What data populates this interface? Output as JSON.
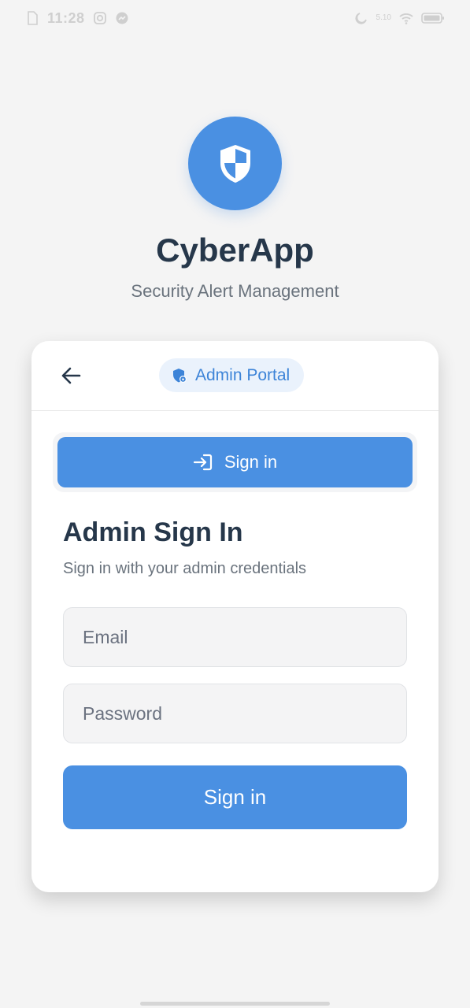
{
  "status_bar": {
    "time": "11:28",
    "icons_left": [
      "file-icon",
      "instagram-icon",
      "messenger-icon"
    ],
    "icons_right": [
      "moon-icon",
      "network-speed-icon",
      "wifi-icon",
      "battery-icon"
    ],
    "network_speed": "5.10"
  },
  "branding": {
    "app_name": "CyberApp",
    "subtitle": "Security Alert Management",
    "logo_icon": "shield-icon",
    "accent_color": "#4a90e2"
  },
  "card": {
    "back_icon": "arrow-left-icon",
    "badge_label": "Admin Portal",
    "badge_icon": "shield-lock-icon",
    "tab_label": "Sign in",
    "tab_icon": "login-icon",
    "form_title": "Admin Sign In",
    "form_subtitle": "Sign in with your admin credentials",
    "email_placeholder": "Email",
    "email_value": "",
    "password_placeholder": "Password",
    "password_value": "",
    "submit_label": "Sign in"
  }
}
